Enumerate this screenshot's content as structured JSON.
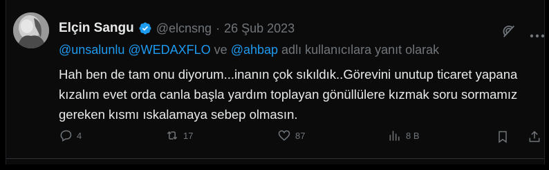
{
  "author": {
    "name": "Elçin Sangu",
    "handle": "@elcnsng",
    "separator": "·",
    "date": "26 Şub 2023",
    "verified_color": "#1d9bf0"
  },
  "reply_context": {
    "mentions": [
      "@unsalunlu",
      "@WEDAXFLO",
      "@ahbap"
    ],
    "joiner": "ve",
    "suffix": "adlı kullanıcılara yanıt olarak"
  },
  "tweet": {
    "text": "Hah ben de tam onu diyorum...inanın çok sıkıldık..Görevini unutup ticaret yapana kızalım evet orda canla başla yardım toplayan gönüllülere kızmak soru sormamız gereken kısmı ıskalamaya sebep olmasın."
  },
  "actions": {
    "replies": "4",
    "retweets": "17",
    "likes": "87",
    "views": "8 B"
  },
  "icons": [
    "grok-icon",
    "more-icon",
    "reply-icon",
    "retweet-icon",
    "like-icon",
    "views-icon",
    "bookmark-icon",
    "share-icon"
  ],
  "colors": {
    "background": "#000000",
    "text": "#e7e9ea",
    "muted": "#71767b",
    "accent": "#1d9bf0"
  }
}
